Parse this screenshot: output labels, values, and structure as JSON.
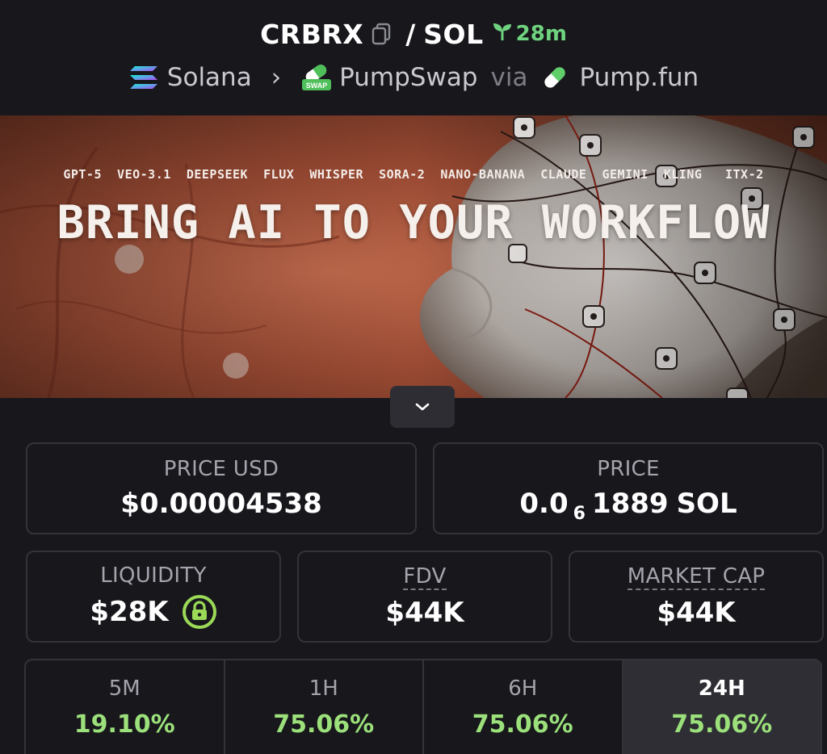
{
  "pair": {
    "base": "CRBRX",
    "separator": "/",
    "quote": "SOL",
    "age": "28m"
  },
  "route": {
    "chain": "Solana",
    "dex": "PumpSwap",
    "via": "via",
    "launchpad": "Pump.fun",
    "dex_badge_text": "SWAP"
  },
  "banner": {
    "models": "GPT-5  VEO-3.1  DEEPSEEK  FLUX  WHISPER  SORA-2  NANO-BANANA  CLAUDE  GEMINI  KLING   ITX-2",
    "headline": "BRING AI TO YOUR WORKFLOW"
  },
  "stats": {
    "price_usd": {
      "label": "PRICE USD",
      "value": "$0.00004538"
    },
    "price_native": {
      "label": "PRICE",
      "prefix": "0.0",
      "zeros": "6",
      "digits": "1889",
      "unit": "SOL"
    },
    "liquidity": {
      "label": "LIQUIDITY",
      "value": "$28K"
    },
    "fdv": {
      "label": "FDV",
      "value": "$44K"
    },
    "market_cap": {
      "label": "MARKET CAP",
      "value": "$44K"
    }
  },
  "changes": [
    {
      "label": "5M",
      "value": "19.10%"
    },
    {
      "label": "1H",
      "value": "75.06%"
    },
    {
      "label": "6H",
      "value": "75.06%"
    },
    {
      "label": "24H",
      "value": "75.06%",
      "active": true
    }
  ],
  "colors": {
    "positive": "#9be07a",
    "age_green": "#6fd27e",
    "lock_green": "#9bd957",
    "background": "#17171c"
  },
  "icons": {
    "copy": "copy-icon",
    "age": "seedling-icon",
    "chain": "solana-logo-icon",
    "dex": "pumpswap-logo-icon",
    "launchpad": "pill-icon",
    "chevron": "chevron-down-icon",
    "lock": "lock-icon"
  }
}
